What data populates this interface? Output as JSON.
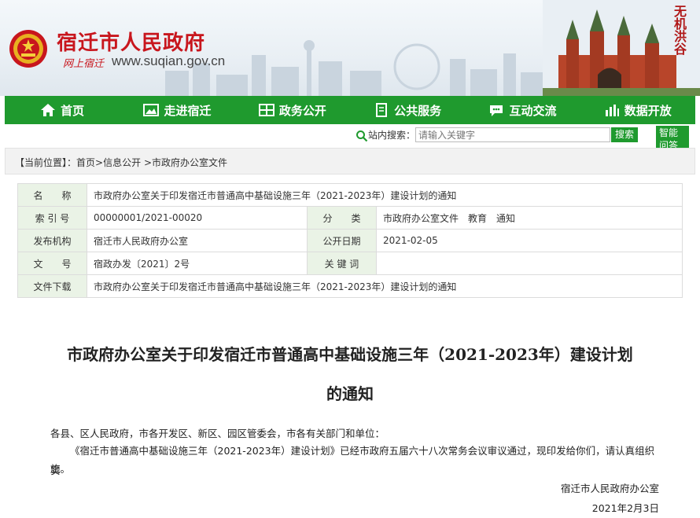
{
  "header": {
    "site_title": "宿迁市人民政府",
    "slogan": "网上宿迁",
    "url": "www.suqian.gov.cn",
    "calligraphy": "无机洪谷"
  },
  "nav": {
    "items": [
      {
        "label": "首页",
        "icon": "home-icon"
      },
      {
        "label": "走进宿迁",
        "icon": "picture-icon"
      },
      {
        "label": "政务公开",
        "icon": "grid-icon"
      },
      {
        "label": "公共服务",
        "icon": "document-icon"
      },
      {
        "label": "互动交流",
        "icon": "chat-icon"
      },
      {
        "label": "数据开放",
        "icon": "chart-icon"
      }
    ]
  },
  "search": {
    "label": "站内搜索：",
    "placeholder": "请输入关键字",
    "button": "搜索",
    "smart_qa": "智能问答"
  },
  "breadcrumb": {
    "prefix": "【当前位置】：",
    "items": [
      "首页",
      "信息公开",
      "市政府办公室文件"
    ],
    "separator": ">"
  },
  "meta": {
    "name_label": "名　　称",
    "name_value": "市政府办公室关于印发宿迁市普通高中基础设施三年（2021-2023年）建设计划的通知",
    "index_label": "索 引 号",
    "index_value": "00000001/2021-00020",
    "category_label": "分　　类",
    "category_value": "市政府办公室文件　教育　通知",
    "issuer_label": "发布机构",
    "issuer_value": "宿迁市人民政府办公室",
    "date_label": "公开日期",
    "date_value": "2021-02-05",
    "docno_label": "文　　号",
    "docno_value": "宿政办发〔2021〕2号",
    "keywords_label": "关 键 词",
    "keywords_value": "",
    "download_label": "文件下载",
    "download_value": "市政府办公室关于印发宿迁市普通高中基础设施三年（2021-2023年）建设计划的通知"
  },
  "article": {
    "title_line1": "市政府办公室关于印发宿迁市普通高中基础设施三年（2021-2023年）建设计划",
    "title_line2": "的通知",
    "salutation": "各县、区人民政府，市各开发区、新区、园区管委会，市各有关部门和单位：",
    "para1_line1": "《宿迁市普通高中基础设施三年（2021-2023年）建设计划》已经市政府五届六十八次常务会议审议通过，现印发给你们，请认真组织实",
    "para1_line2": "施。",
    "signer": "宿迁市人民政府办公室",
    "sign_date": "2021年2月3日"
  },
  "colors": {
    "brand_red": "#c8161d",
    "nav_green": "#1f9a2e",
    "label_bg": "#eaf3e6"
  }
}
